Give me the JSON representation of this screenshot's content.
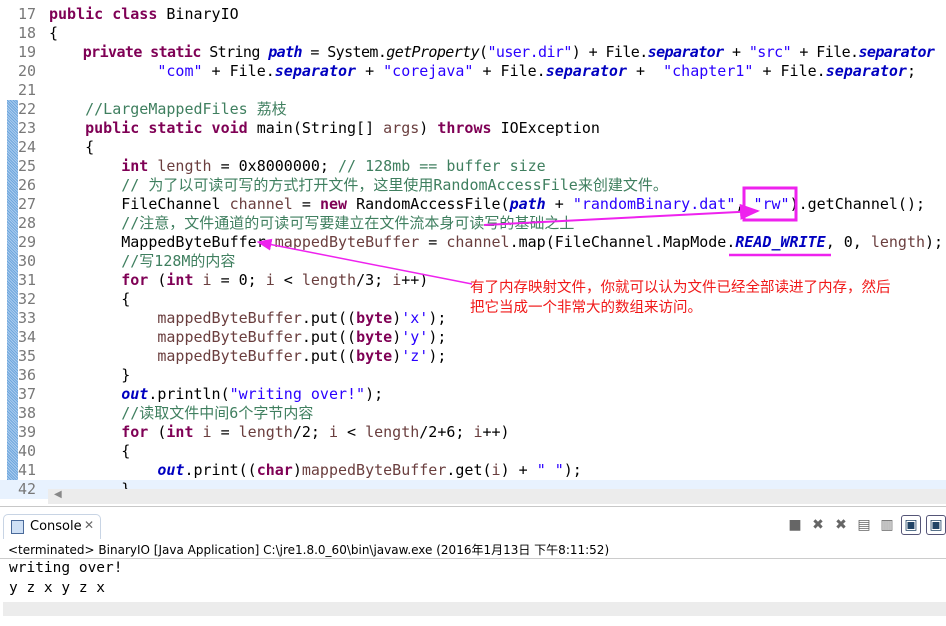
{
  "editor": {
    "lines": [
      {
        "n": "17",
        "t": [
          [
            "k",
            "public class "
          ],
          [
            "p",
            "BinaryIO"
          ]
        ]
      },
      {
        "n": "18",
        "t": [
          [
            "p",
            "{"
          ]
        ]
      },
      {
        "n": "19",
        "t": [
          [
            "p",
            "    "
          ],
          [
            "k",
            "private static "
          ],
          [
            "p",
            "String "
          ],
          [
            "f",
            "path"
          ],
          [
            "p",
            " = System."
          ],
          [
            "i",
            "getProperty"
          ],
          [
            "p",
            "("
          ],
          [
            "s",
            "\"user.dir\""
          ],
          [
            "p",
            ") + File."
          ],
          [
            "f",
            "separator"
          ],
          [
            "p",
            " + "
          ],
          [
            "s",
            "\"src\""
          ],
          [
            "p",
            " + File."
          ],
          [
            "f",
            "separator"
          ]
        ]
      },
      {
        "n": "20",
        "t": [
          [
            "p",
            "            "
          ],
          [
            "s",
            "\"com\""
          ],
          [
            "p",
            " + File."
          ],
          [
            "f",
            "separator"
          ],
          [
            "p",
            " + "
          ],
          [
            "s",
            "\"corejava\""
          ],
          [
            "p",
            " + File."
          ],
          [
            "f",
            "separator"
          ],
          [
            "p",
            " +  "
          ],
          [
            "s",
            "\"chapter1\""
          ],
          [
            "p",
            " + File."
          ],
          [
            "f",
            "separator"
          ],
          [
            "p",
            ";"
          ]
        ]
      },
      {
        "n": "21",
        "t": []
      },
      {
        "n": "22",
        "t": [
          [
            "p",
            "    "
          ],
          [
            "c",
            "//LargeMappedFiles 荔枝"
          ]
        ]
      },
      {
        "n": "23",
        "t": [
          [
            "p",
            "    "
          ],
          [
            "k",
            "public static void "
          ],
          [
            "p",
            "main(String[] "
          ],
          [
            "v",
            "args"
          ],
          [
            "p",
            ") "
          ],
          [
            "k",
            "throws "
          ],
          [
            "p",
            "IOException"
          ]
        ]
      },
      {
        "n": "24",
        "t": [
          [
            "p",
            "    {"
          ]
        ]
      },
      {
        "n": "25",
        "t": [
          [
            "p",
            "        "
          ],
          [
            "k",
            "int "
          ],
          [
            "v",
            "length"
          ],
          [
            "p",
            " = 0x8000000; "
          ],
          [
            "c",
            "// 128mb == buffer size"
          ]
        ]
      },
      {
        "n": "26",
        "t": [
          [
            "p",
            "        "
          ],
          [
            "c",
            "// 为了以可读可写的方式打开文件，这里使用RandomAccessFile来创建文件。"
          ]
        ]
      },
      {
        "n": "27",
        "t": [
          [
            "p",
            "        FileChannel "
          ],
          [
            "v",
            "channel"
          ],
          [
            "p",
            " = "
          ],
          [
            "k",
            "new "
          ],
          [
            "p",
            "RandomAccessFile("
          ],
          [
            "f",
            "path"
          ],
          [
            "p",
            " + "
          ],
          [
            "s",
            "\"randomBinary.dat\""
          ],
          [
            "p",
            ", "
          ],
          [
            "s",
            "\"rw\""
          ],
          [
            "p",
            ").getChannel();"
          ]
        ]
      },
      {
        "n": "28",
        "t": [
          [
            "p",
            "        "
          ],
          [
            "c",
            "//注意，文件通道的可读可写要建立在文件流本身可读写的基础之上"
          ]
        ]
      },
      {
        "n": "29",
        "t": [
          [
            "p",
            "        MappedByteBuffer "
          ],
          [
            "v",
            "mappedByteBuffer"
          ],
          [
            "p",
            " = "
          ],
          [
            "v",
            "channel"
          ],
          [
            "p",
            ".map(FileChannel.MapMode."
          ],
          [
            "f",
            "READ_WRITE"
          ],
          [
            "p",
            ", 0, "
          ],
          [
            "v",
            "length"
          ],
          [
            "p",
            ");"
          ]
        ]
      },
      {
        "n": "30",
        "t": [
          [
            "p",
            "        "
          ],
          [
            "c",
            "//写128M的内容"
          ]
        ]
      },
      {
        "n": "31",
        "t": [
          [
            "p",
            "        "
          ],
          [
            "k",
            "for "
          ],
          [
            "p",
            "("
          ],
          [
            "k",
            "int "
          ],
          [
            "v",
            "i"
          ],
          [
            "p",
            " = 0; "
          ],
          [
            "v",
            "i"
          ],
          [
            "p",
            " < "
          ],
          [
            "v",
            "length"
          ],
          [
            "p",
            "/3; "
          ],
          [
            "v",
            "i"
          ],
          [
            "p",
            "++)"
          ]
        ]
      },
      {
        "n": "32",
        "t": [
          [
            "p",
            "        {"
          ]
        ]
      },
      {
        "n": "33",
        "t": [
          [
            "p",
            "            "
          ],
          [
            "v",
            "mappedByteBuffer"
          ],
          [
            "p",
            ".put(("
          ],
          [
            "k",
            "byte"
          ],
          [
            "p",
            ")"
          ],
          [
            "s",
            "'x'"
          ],
          [
            "p",
            ");"
          ]
        ]
      },
      {
        "n": "34",
        "t": [
          [
            "p",
            "            "
          ],
          [
            "v",
            "mappedByteBuffer"
          ],
          [
            "p",
            ".put(("
          ],
          [
            "k",
            "byte"
          ],
          [
            "p",
            ")"
          ],
          [
            "s",
            "'y'"
          ],
          [
            "p",
            ");"
          ]
        ]
      },
      {
        "n": "35",
        "t": [
          [
            "p",
            "            "
          ],
          [
            "v",
            "mappedByteBuffer"
          ],
          [
            "p",
            ".put(("
          ],
          [
            "k",
            "byte"
          ],
          [
            "p",
            ")"
          ],
          [
            "s",
            "'z'"
          ],
          [
            "p",
            ");"
          ]
        ]
      },
      {
        "n": "36",
        "t": [
          [
            "p",
            "        }"
          ]
        ]
      },
      {
        "n": "37",
        "t": [
          [
            "p",
            "        "
          ],
          [
            "f",
            "out"
          ],
          [
            "p",
            ".println("
          ],
          [
            "s",
            "\"writing over!\""
          ],
          [
            "p",
            ");"
          ]
        ]
      },
      {
        "n": "38",
        "t": [
          [
            "p",
            "        "
          ],
          [
            "c",
            "//读取文件中间6个字节内容"
          ]
        ]
      },
      {
        "n": "39",
        "t": [
          [
            "p",
            "        "
          ],
          [
            "k",
            "for "
          ],
          [
            "p",
            "("
          ],
          [
            "k",
            "int "
          ],
          [
            "v",
            "i"
          ],
          [
            "p",
            " = "
          ],
          [
            "v",
            "length"
          ],
          [
            "p",
            "/2; "
          ],
          [
            "v",
            "i"
          ],
          [
            "p",
            " < "
          ],
          [
            "v",
            "length"
          ],
          [
            "p",
            "/2+6; "
          ],
          [
            "v",
            "i"
          ],
          [
            "p",
            "++)"
          ]
        ]
      },
      {
        "n": "40",
        "t": [
          [
            "p",
            "        {"
          ]
        ]
      },
      {
        "n": "41",
        "t": [
          [
            "p",
            "            "
          ],
          [
            "f",
            "out"
          ],
          [
            "p",
            ".print(("
          ],
          [
            "k",
            "char"
          ],
          [
            "p",
            ")"
          ],
          [
            "v",
            "mappedByteBuffer"
          ],
          [
            "p",
            ".get("
          ],
          [
            "v",
            "i"
          ],
          [
            "p",
            ") + "
          ],
          [
            "s",
            "\" \""
          ],
          [
            "p",
            ");"
          ]
        ]
      },
      {
        "n": "42",
        "t": [
          [
            "p",
            "        }"
          ]
        ]
      }
    ]
  },
  "annotation": {
    "line1": "有了内存映射文件，你就可以认为文件已经全部读进了内存，然后",
    "line2": "把它当成一个非常大的数组来访问。",
    "color": "#f01818",
    "marker_color": "#ee22ee"
  },
  "console": {
    "tab_label": "Console",
    "close_glyph": "✕",
    "status": "<terminated> BinaryIO [Java Application] C:\\jre1.8.0_60\\bin\\javaw.exe (2016年1月13日 下午8:11:52)",
    "output": [
      "writing over!",
      "y z x y z x"
    ],
    "tools": [
      "terminate-icon",
      "remove-launch-icon",
      "remove-all-icon",
      "clear-console-icon",
      "scroll-lock-icon",
      "pin-console-icon",
      "display-console-icon"
    ]
  }
}
